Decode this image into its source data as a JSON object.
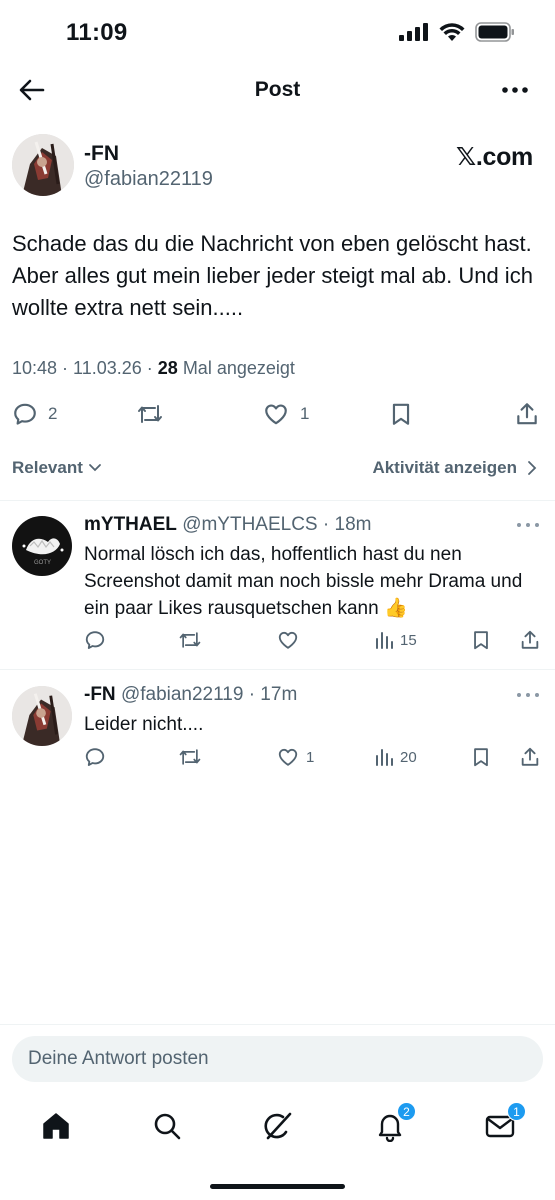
{
  "status_bar": {
    "time": "11:09"
  },
  "nav": {
    "title": "Post"
  },
  "post": {
    "author_name": "-FN",
    "author_handle": "@fabian22119",
    "brand": "𝕏.com",
    "text": "Schade das du die Nachricht von eben gelöscht hast. Aber alles gut mein lieber jeder steigt mal ab. Und ich wollte extra nett sein.....",
    "timestamp": "10:48 · 11.03.26 · ",
    "views": "28",
    "views_label": " Mal angezeigt",
    "replies": "2",
    "reposts": "",
    "likes": "1"
  },
  "sort": {
    "label": "Relevant",
    "activity": "Aktivität anzeigen"
  },
  "replies": [
    {
      "name": "mYTHAEL",
      "handle": "@mYTHAELCS",
      "time": "· 18m",
      "text": "Normal lösch ich das, hoffentlich hast du nen Screenshot damit man noch bissle mehr Drama und ein paar Likes rausquetschen kann 👍",
      "replies": "",
      "reposts": "",
      "likes": "",
      "views": "15"
    },
    {
      "name": "-FN",
      "handle": "@fabian22119",
      "time": "· 17m",
      "text": "Leider nicht....",
      "replies": "",
      "reposts": "",
      "likes": "1",
      "views": "20"
    }
  ],
  "composer": {
    "placeholder": "Deine Antwort posten"
  },
  "tabbar": {
    "notifications_badge": "2",
    "messages_badge": "1"
  },
  "colors": {
    "text": "#0f1419",
    "secondary": "#536471",
    "accent": "#1d9bf0",
    "divider": "#eff3f4"
  },
  "icons": [
    "back-arrow-icon",
    "more-icon",
    "reply-icon",
    "repost-icon",
    "like-icon",
    "bookmark-icon",
    "share-icon",
    "views-icon",
    "home-icon",
    "search-icon",
    "grok-icon",
    "bell-icon",
    "mail-icon"
  ]
}
